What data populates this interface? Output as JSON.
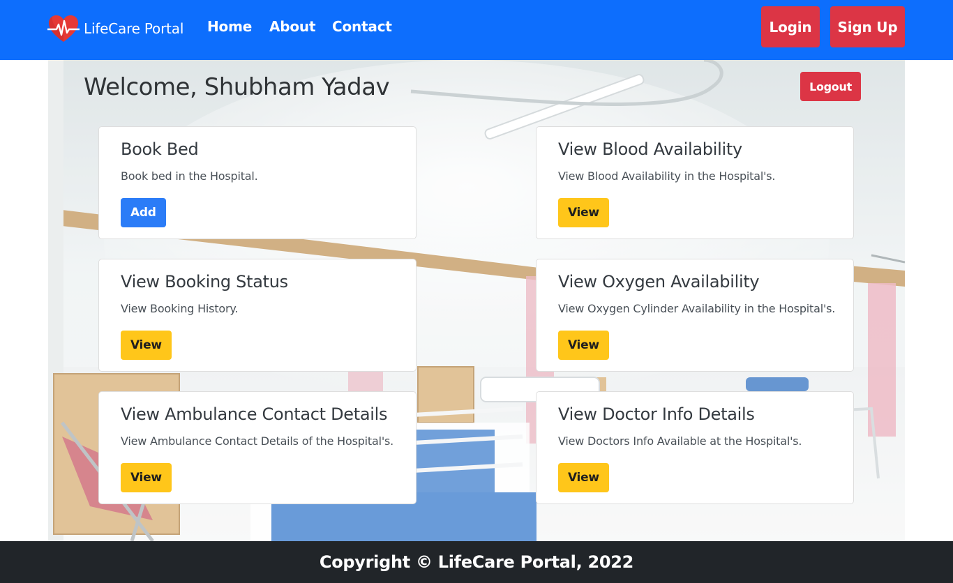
{
  "navbar": {
    "brand": "LifeCare Portal",
    "links": [
      "Home",
      "About",
      "Contact"
    ],
    "login_label": "Login",
    "signup_label": "Sign Up",
    "color": "#0d6efd"
  },
  "main": {
    "welcome": "Welcome, Shubham Yadav",
    "logout_label": "Logout",
    "cards": [
      {
        "title": "Book Bed",
        "text": "Book bed in the Hospital.",
        "button": "Add"
      },
      {
        "title": "View Blood Availability",
        "text": "View Blood Availability in the Hospital's.",
        "button": "View"
      },
      {
        "title": "View Booking Status",
        "text": "View Booking History.",
        "button": "View"
      },
      {
        "title": "View Oxygen Availability",
        "text": "View Oxygen Cylinder Availability in the Hospital's.",
        "button": "View"
      },
      {
        "title": "View Ambulance Contact Details",
        "text": "View Ambulance Contact Details of the Hospital's.",
        "button": "View"
      },
      {
        "title": "View Doctor Info Details",
        "text": "View Doctors Info Available at the Hospital's.",
        "button": "View"
      }
    ]
  },
  "footer": {
    "text": "Copyright © LifeCare Portal, 2022"
  },
  "colors": {
    "danger": "#dc3545",
    "primary": "#2b7cf7",
    "warning": "#ffc61a",
    "footer_bg": "#212529"
  },
  "icons": {
    "brand": "heart-pulse-icon"
  }
}
